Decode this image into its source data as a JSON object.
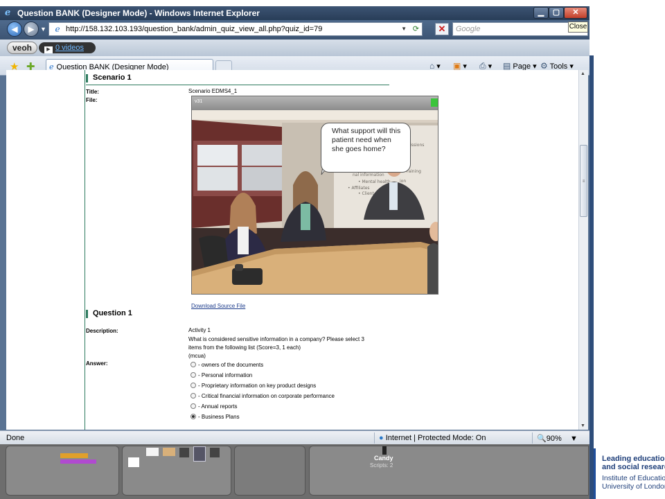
{
  "window": {
    "title": "Question BANK (Designer Mode) - Windows Internet Explorer",
    "close_tooltip": "Close"
  },
  "addressbar": {
    "url": "http://158.132.103.193/question_bank/admin_quiz_view_all.php?quiz_id=79",
    "search_placeholder": "Google"
  },
  "veoh": {
    "logo": "veoh",
    "videos": "0 videos"
  },
  "tabs": [
    {
      "label": "Question BANK (Designer Mode)"
    }
  ],
  "toolbar": {
    "page_label": "Page",
    "tools_label": "Tools"
  },
  "scenario": {
    "heading": "Scenario 1",
    "title_label": "Title:",
    "title_value": "Scenario EDMS4_1",
    "file_label": "File:",
    "media_version": "v31",
    "speech_bubble": "What support will this patient need when she goes home?",
    "download_link": "Download Source File"
  },
  "question": {
    "heading": "Question 1",
    "description_label": "Description:",
    "description_lines": [
      "Activity 1",
      "What is considered sensitive information in a company? Please select 3",
      "items from the following list (Score=3, 1 each)",
      "(mcua)"
    ],
    "answer_label": "Answer:",
    "options": [
      {
        "label": "- owners of the documents",
        "selected": false
      },
      {
        "label": "- Personal information",
        "selected": false
      },
      {
        "label": "- Proprietary information on key product designs",
        "selected": false
      },
      {
        "label": "- Critical financial information on corporate performance",
        "selected": false
      },
      {
        "label": "- Annual reports",
        "selected": false
      },
      {
        "label": "- Business Plans",
        "selected": true
      }
    ]
  },
  "statusbar": {
    "status": "Done",
    "zone": "Internet | Protected Mode: On",
    "zoom": "90%"
  },
  "scratch": {
    "sprite_name": "Candy",
    "sprite_scripts": "Scripts: 2"
  },
  "branding": {
    "line1": "Leading education",
    "line2": "and social research",
    "line3": "Institute of Education",
    "line4": "University of London"
  },
  "colors": {
    "accent_green": "#2e7b5f",
    "title_bar": "#283d58",
    "ioe_blue": "#1f3f7a"
  }
}
